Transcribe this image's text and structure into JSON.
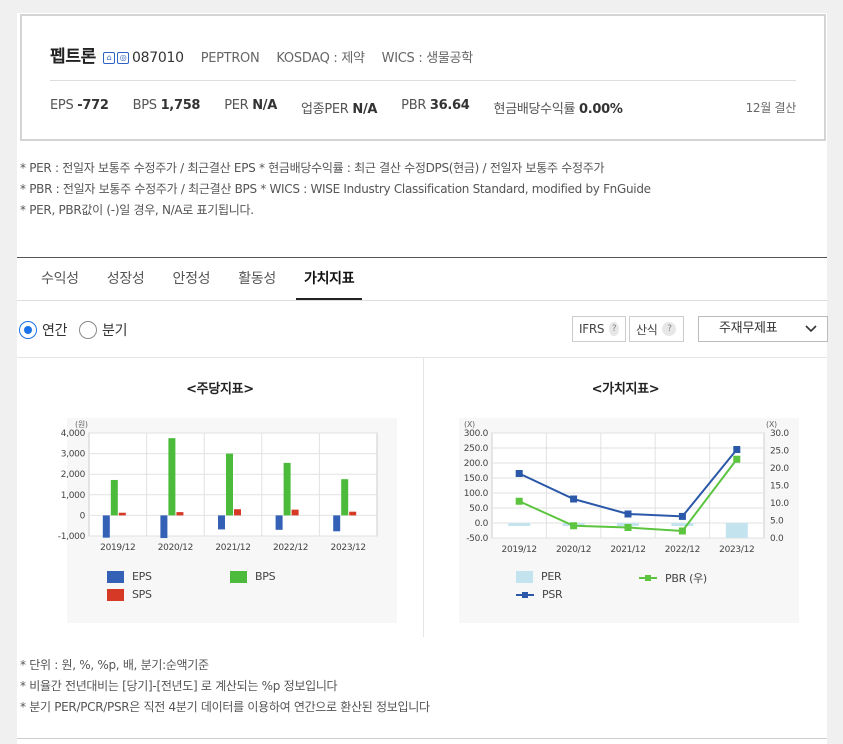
{
  "company": {
    "name": "펩트론",
    "code": "087010",
    "english_name": "PEPTRON",
    "market": "KOSDAQ : 제약",
    "wics": "WICS : 생물공학",
    "icons": [
      "home-icon",
      "ir-icon"
    ]
  },
  "stats": [
    {
      "label": "EPS",
      "value": "-772"
    },
    {
      "label": "BPS",
      "value": "1,758"
    },
    {
      "label": "PER",
      "value": "N/A"
    },
    {
      "label": "업종PER",
      "value": "N/A"
    },
    {
      "label": "PBR",
      "value": "36.64"
    },
    {
      "label": "현금배당수익률",
      "value": "0.00%"
    }
  ],
  "settlement": "12월 결산",
  "notes_top": [
    "* PER : 전일자 보통주 수정주가 / 최근결산 EPS * 현금배당수익률 : 최근 결산 수정DPS(현금) / 전일자 보통주 수정주가",
    "* PBR : 전일자 보통주 수정주가 / 최근결산 BPS * WICS : WISE Industry Classification Standard, modified by FnGuide",
    "* PER, PBR값이 (-)일 경우, N/A로 표기됩니다."
  ],
  "tabs": [
    "수익성",
    "성장성",
    "안정성",
    "활동성",
    "가치지표"
  ],
  "active_tab": 4,
  "period": {
    "annual": "연간",
    "quarter": "분기",
    "selected": "annual"
  },
  "ifrs_label": "IFRS",
  "calc_label": "산식",
  "help_glyph": "?",
  "select_value": "주재무제표",
  "colors": {
    "eps": "#3461b5",
    "bps": "#4cbb3c",
    "sps": "#d63a26",
    "per": "#c3e3ee",
    "pbr": "#5cc43f",
    "psr": "#2b58a8"
  },
  "chart_data": [
    {
      "type": "bar",
      "title": "<주당지표>",
      "unit": "(원)",
      "categories": [
        "2019/12",
        "2020/12",
        "2021/12",
        "2022/12",
        "2023/12"
      ],
      "ylim": [
        -1000,
        4000
      ],
      "yticks": [
        "4,000",
        "3,000",
        "2,000",
        "1,000",
        "0",
        "-1,000"
      ],
      "series": [
        {
          "name": "EPS",
          "values": [
            -1080,
            -1100,
            -680,
            -700,
            -772
          ]
        },
        {
          "name": "BPS",
          "values": [
            1720,
            3750,
            3000,
            2550,
            1758
          ]
        },
        {
          "name": "SPS",
          "values": [
            130,
            160,
            300,
            280,
            180
          ]
        }
      ],
      "grid": true,
      "legend": "bottom"
    },
    {
      "type": "line",
      "title": "<가치지표>",
      "left_unit": "(X)",
      "right_unit": "(X)",
      "categories": [
        "2019/12",
        "2020/12",
        "2021/12",
        "2022/12",
        "2023/12"
      ],
      "ylim_left": [
        -50,
        300
      ],
      "ylim_right": [
        0,
        30
      ],
      "yticks_left": [
        "300.0",
        "250.0",
        "200.0",
        "150.0",
        "100.0",
        "50.0",
        "0.0",
        "-50.0"
      ],
      "yticks_right": [
        "30.0",
        "25.0",
        "20.0",
        "15.0",
        "10.0",
        "5.0",
        "0.0"
      ],
      "series": [
        {
          "name": "PER",
          "axis": "left",
          "kind": "bar",
          "values": [
            -10,
            -10,
            -10,
            -10,
            -50
          ]
        },
        {
          "name": "PBR (우)",
          "axis": "right",
          "kind": "line",
          "values": [
            10.5,
            3.5,
            3.0,
            2.0,
            22.5
          ]
        },
        {
          "name": "PSR",
          "axis": "left",
          "kind": "line",
          "values": [
            165,
            80,
            30,
            22,
            245
          ]
        }
      ],
      "grid": true,
      "legend": "bottom"
    }
  ],
  "notes_bottom": [
    "* 단위 : 원, %, %p, 배, 분기:순액기준",
    "* 비율간 전년대비는 [당기]-[전년도] 로 계산되는 %p 정보입니다",
    "* 분기 PER/PCR/PSR은 직전 4분기 데이터를 이용하여 연간으로 환산된 정보입니다"
  ]
}
